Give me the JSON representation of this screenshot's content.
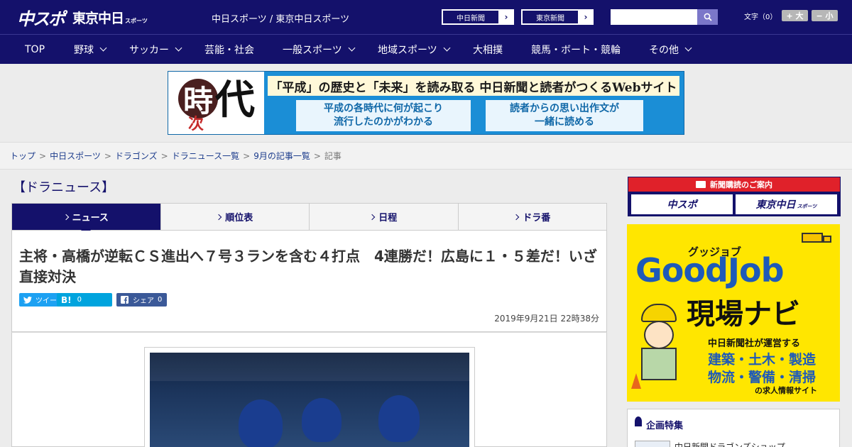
{
  "header": {
    "logo_main": "中スポ",
    "logo_sub": "東京中日",
    "logo_small": "スポーツ",
    "site_subtitle": "中日スポーツ / 東京中日スポーツ",
    "link1": "中日新聞",
    "link2": "東京新聞",
    "search_placeholder": "",
    "font_size_label": "文字（0）",
    "font_up": "+ 大",
    "font_down": "− 小"
  },
  "nav": {
    "items": [
      {
        "label": "TOP"
      },
      {
        "label": "野球"
      },
      {
        "label": "サッカー"
      },
      {
        "label": "芸能・社会"
      },
      {
        "label": "一般スポーツ"
      },
      {
        "label": "地域スポーツ"
      },
      {
        "label": "大相撲"
      },
      {
        "label": "競馬・ボート・競輪"
      },
      {
        "label": "その他"
      }
    ]
  },
  "banner": {
    "kanji_ji": "時",
    "kanji_ci": "次",
    "kanji_dai": "代",
    "headline": "「平成」の歴史と「未来」を読み取る 中日新聞と読者がつくるWebサイト",
    "box1_line1": "平成の各時代に何が起こり",
    "box1_line2": "流行したのかがわかる",
    "box2_line1": "読者からの思い出作文が",
    "box2_line2": "一緒に読める"
  },
  "breadcrumb": {
    "items": [
      "トップ",
      "中日スポーツ",
      "ドラゴンズ",
      "ドラニュース一覧",
      "9月の記事一覧"
    ],
    "current": "記事",
    "sep": ">"
  },
  "main": {
    "section_title": "【ドラニュース】",
    "tabs": [
      {
        "label": "ニュース",
        "active": true
      },
      {
        "label": "順位表"
      },
      {
        "label": "日程"
      },
      {
        "label": "ドラ番"
      }
    ],
    "headline": "主将・高橋が逆転ＣＳ進出へ７号３ランを含む４打点　4連勝だ！広島に１・５差だ！いざ直接対決",
    "share": {
      "tweet": "ツイート",
      "hatena": "B!",
      "hatena_count": "0",
      "fb": "シェア",
      "fb_count": "0"
    },
    "date": "2019年9月21日 22時38分"
  },
  "sidebar": {
    "subscribe_title": "新聞購読のご案内",
    "sub_btn1": "中スポ",
    "sub_btn2": "東京中日",
    "sub_btn2_small": "スポーツ",
    "gj_kana": "グッジョブ",
    "gj_title": "GoodJob",
    "gj_sub": "現場ナビ",
    "gj_line1": "中日新聞社が運営する",
    "gj_line2": "建築・土木・製造",
    "gj_line3": "物流・警備・清掃",
    "gj_line4": "の求人情報サイト",
    "feature_title": "企画特集",
    "feature_item": "中日新聞ドラゴンズショップ"
  },
  "colors": {
    "brand": "#14116b",
    "accent_red": "#e0212a",
    "twitter": "#1da1f2",
    "hatena": "#00a4de",
    "facebook": "#3b5998"
  }
}
